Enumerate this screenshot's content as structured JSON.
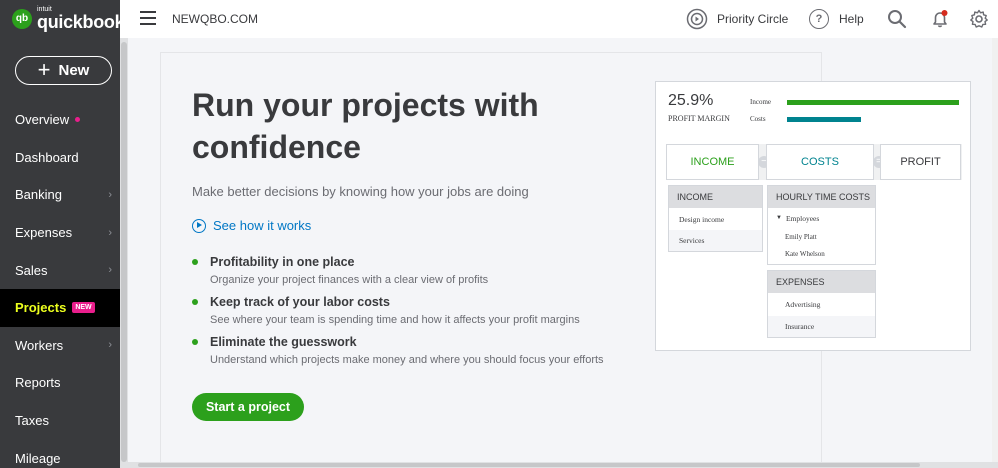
{
  "brand": {
    "intuit": "intuit",
    "name": "quickbooks",
    "logo_mark": "qb"
  },
  "sidebar": {
    "new_label": "New",
    "items": [
      {
        "label": "Overview",
        "dot": true,
        "chevron": false,
        "active": false
      },
      {
        "label": "Dashboard",
        "dot": false,
        "chevron": false,
        "active": false
      },
      {
        "label": "Banking",
        "dot": false,
        "chevron": true,
        "active": false
      },
      {
        "label": "Expenses",
        "dot": false,
        "chevron": true,
        "active": false
      },
      {
        "label": "Sales",
        "dot": false,
        "chevron": true,
        "active": false
      },
      {
        "label": "Projects",
        "badge": "NEW",
        "dot": false,
        "chevron": false,
        "active": true
      },
      {
        "label": "Workers",
        "dot": false,
        "chevron": true,
        "active": false
      },
      {
        "label": "Reports",
        "dot": false,
        "chevron": false,
        "active": false
      },
      {
        "label": "Taxes",
        "dot": false,
        "chevron": false,
        "active": false
      },
      {
        "label": "Mileage",
        "dot": false,
        "chevron": false,
        "active": false
      }
    ]
  },
  "header": {
    "company": "NEWQBO.COM",
    "priority_circle": "Priority Circle",
    "help": "Help"
  },
  "hero": {
    "title": "Run your projects with confidence",
    "subtitle": "Make better decisions by knowing how your jobs are doing",
    "see_how": "See how it works",
    "features": [
      {
        "title": "Profitability in one place",
        "desc": "Organize your project finances with a clear view of profits"
      },
      {
        "title": "Keep track of your labor costs",
        "desc": "See where your team is spending time and how it affects your profit margins"
      },
      {
        "title": "Eliminate the guesswork",
        "desc": "Understand which projects make money and where you should focus your efforts"
      }
    ],
    "cta": "Start a project"
  },
  "illustration": {
    "margin_value": "25.9%",
    "margin_label": "PROFIT MARGIN",
    "income_label": "Income",
    "costs_label": "Costs",
    "income_color": "#2ca01c",
    "costs_color": "#00838f",
    "income_fraction": 1.0,
    "costs_fraction": 0.43,
    "eq_income": "INCOME",
    "eq_minus": "−",
    "eq_costs": "COSTS",
    "eq_equals": "=",
    "eq_profit": "PROFIT",
    "income_card": {
      "header": "INCOME",
      "rows": [
        "Design income",
        "Services"
      ]
    },
    "hourly_card": {
      "header": "HOURLY TIME COSTS",
      "group": "Employees",
      "rows": [
        "Emily Platt",
        "Kate Whelson"
      ]
    },
    "expenses_card": {
      "header": "EXPENSES",
      "rows": [
        "Advertising",
        "Insurance"
      ]
    }
  },
  "colors": {
    "accent": "#2ca01c",
    "link": "#0077c5",
    "sidebar": "#393a3d",
    "active_nav": "#ecff1e",
    "badge": "#e91e8c"
  }
}
